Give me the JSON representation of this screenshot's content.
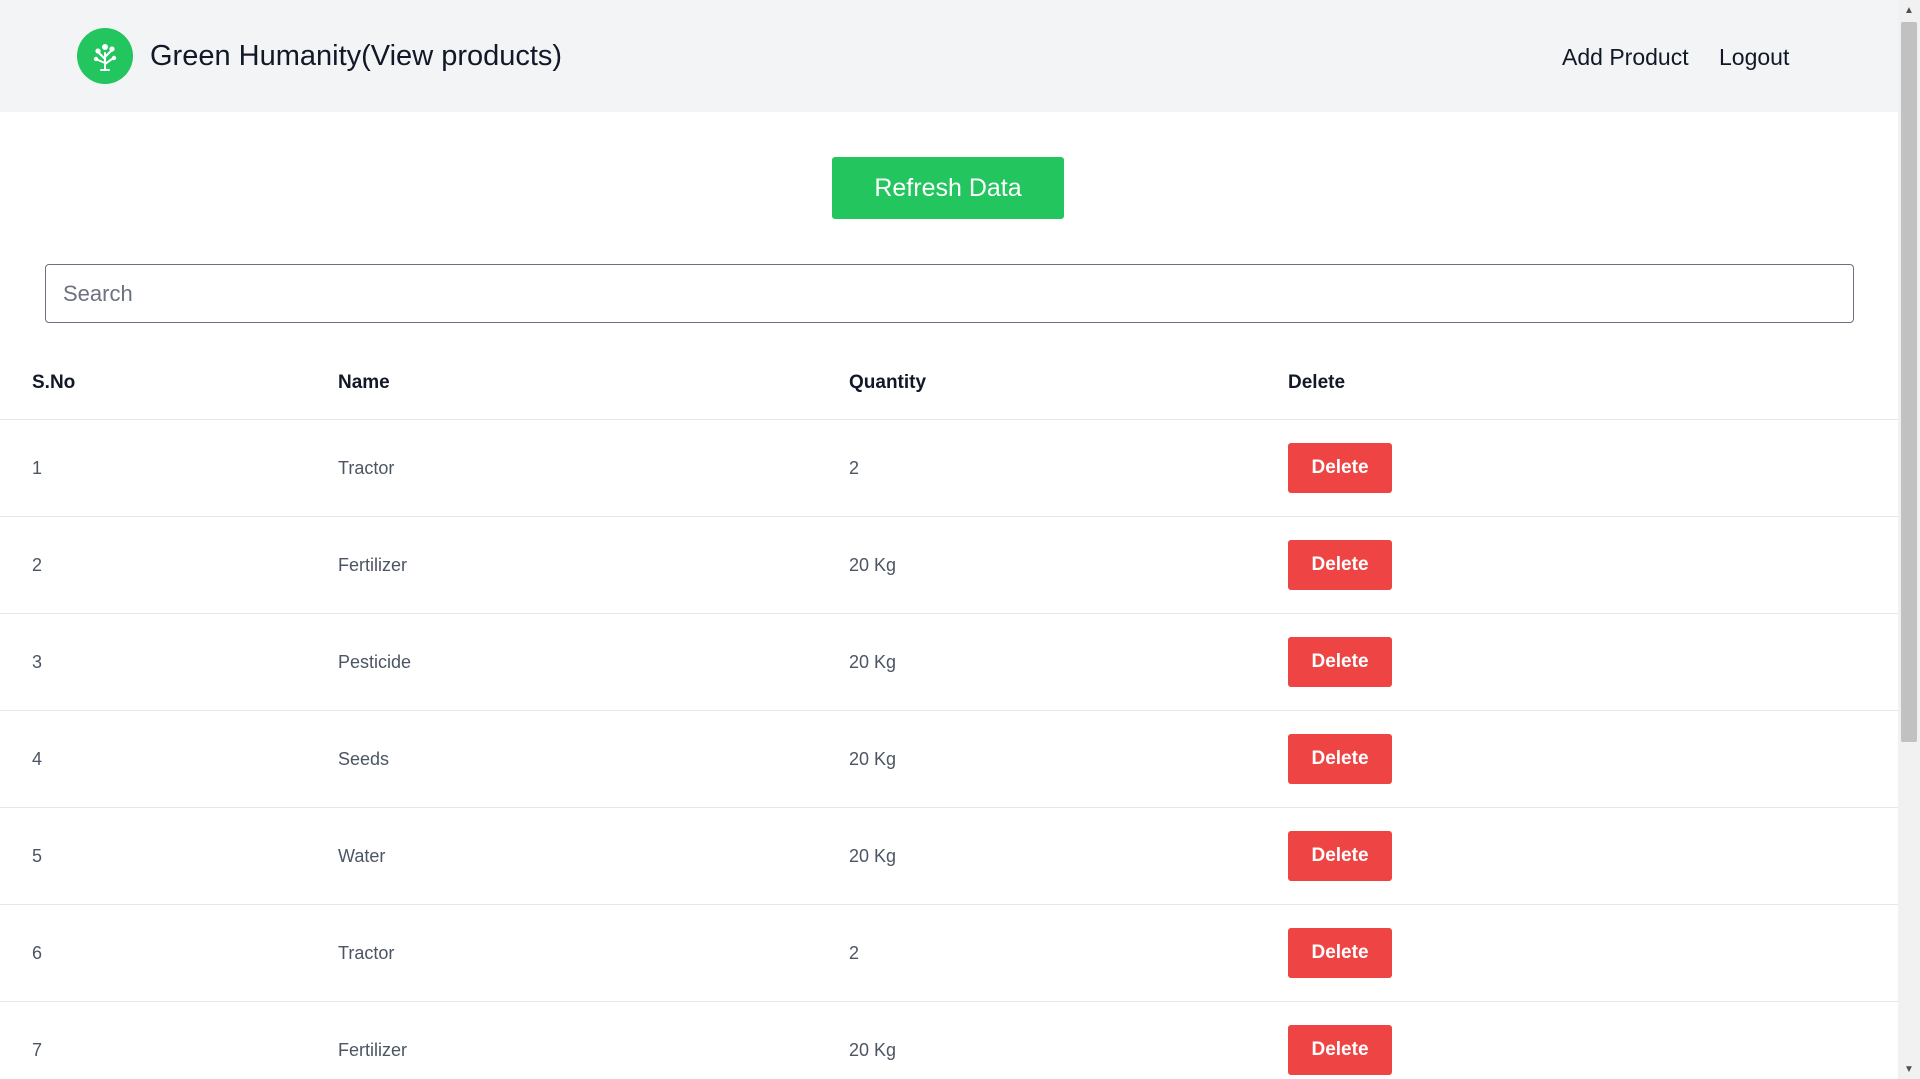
{
  "header": {
    "title": "Green Humanity(View products)",
    "nav": {
      "add_product": "Add Product",
      "logout": "Logout"
    },
    "logo_icon": "tree-icon"
  },
  "actions": {
    "refresh_label": "Refresh Data"
  },
  "search": {
    "placeholder": "Search",
    "value": ""
  },
  "table": {
    "headers": {
      "sno": "S.No",
      "name": "Name",
      "quantity": "Quantity",
      "delete": "Delete"
    },
    "delete_label": "Delete",
    "rows": [
      {
        "sno": "1",
        "name": "Tractor",
        "quantity": "2"
      },
      {
        "sno": "2",
        "name": "Fertilizer",
        "quantity": "20 Kg"
      },
      {
        "sno": "3",
        "name": "Pesticide",
        "quantity": "20 Kg"
      },
      {
        "sno": "4",
        "name": "Seeds",
        "quantity": "20 Kg"
      },
      {
        "sno": "5",
        "name": "Water",
        "quantity": "20 Kg"
      },
      {
        "sno": "6",
        "name": "Tractor",
        "quantity": "2"
      },
      {
        "sno": "7",
        "name": "Fertilizer",
        "quantity": "20 Kg"
      }
    ]
  },
  "colors": {
    "primary_green": "#22c55e",
    "danger_red": "#ef4444",
    "header_bg": "#f3f4f6"
  }
}
